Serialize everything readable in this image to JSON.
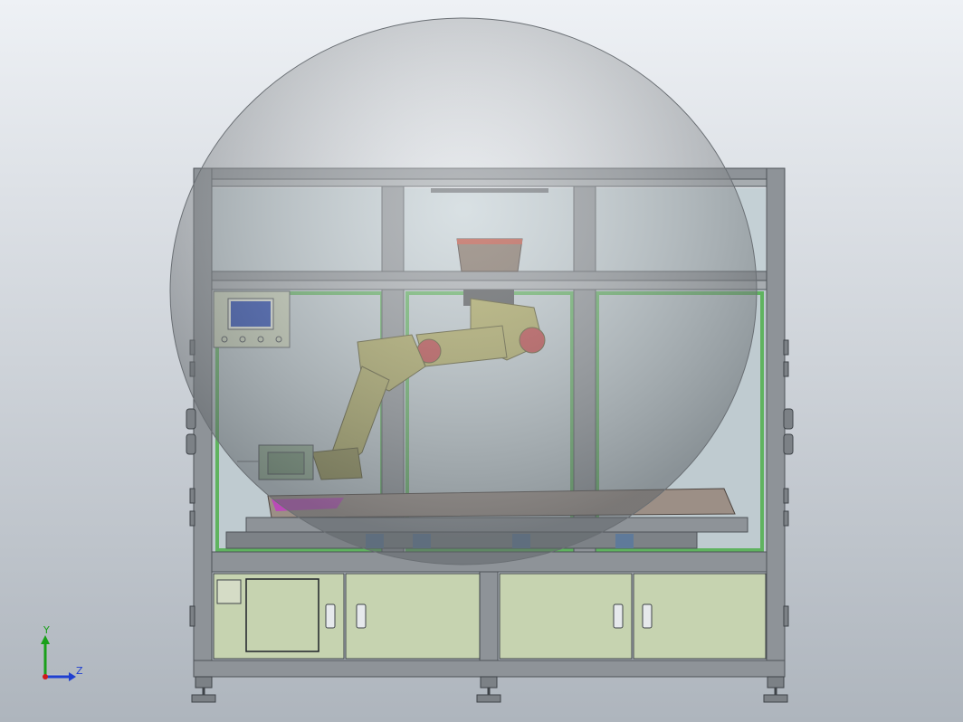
{
  "view": {
    "background": {
      "top": "#eef1f5",
      "bottom": "#aeb5bd"
    }
  },
  "triad": {
    "y_label": "Y",
    "z_label": "Z",
    "colors": {
      "y": "#1aa01a",
      "z": "#1f3fd0",
      "x": "#d01a1a"
    }
  },
  "colors": {
    "frame": "#8e9398",
    "frame_dark": "#5e6368",
    "glass": "#b9c6cc",
    "cabinet": "#c6d3b0",
    "green_trim": "#5fb35f",
    "robot": "#a9a557",
    "robot_dark": "#6e6b34",
    "robot_joint": "#b83a3a",
    "bubble": "#777b80",
    "screen": "#1b3fb0",
    "magenta": "#c040c0"
  }
}
